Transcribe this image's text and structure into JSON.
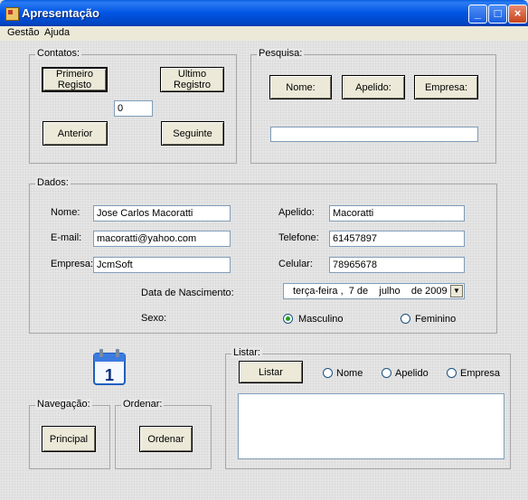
{
  "window": {
    "title": "Apresentação"
  },
  "menu": {
    "items": [
      "Gestão",
      "Ajuda"
    ]
  },
  "contatos": {
    "legend": "Contatos:",
    "first_label": "Primeiro Registo",
    "last_label": "Ultimo Registro",
    "record_index": "0",
    "prev_label": "Anterior",
    "next_label": "Seguinte"
  },
  "pesquisa": {
    "legend": "Pesquisa:",
    "nome_label": "Nome:",
    "apelido_label": "Apelido:",
    "empresa_label": "Empresa:",
    "search_value": ""
  },
  "dados": {
    "legend": "Dados:",
    "nome_label": "Nome:",
    "nome_value": "Jose Carlos Macoratti",
    "email_label": "E-mail:",
    "email_value": "macoratti@yahoo.com",
    "empresa_label": "Empresa:",
    "empresa_value": "JcmSoft",
    "apelido_label": "Apelido:",
    "apelido_value": "Macoratti",
    "telefone_label": "Telefone:",
    "telefone_value": "61457897",
    "celular_label": "Celular:",
    "celular_value": "78965678",
    "nascimento_label": "Data de Nascimento:",
    "nascimento_value": "terça-feira ,  7 de    julho    de 2009",
    "sexo_label": "Sexo:",
    "masculino_label": "Masculino",
    "feminino_label": "Feminino",
    "sexo_selected": "Masculino"
  },
  "navegacao": {
    "legend": "Navegação:",
    "principal_label": "Principal"
  },
  "ordenar": {
    "legend": "Ordenar:",
    "ordenar_label": "Ordenar"
  },
  "listar": {
    "legend": "Listar:",
    "listar_label": "Listar",
    "nome_label": "Nome",
    "apelido_label": "Apelido",
    "empresa_label": "Empresa"
  },
  "icons": {
    "calendar": "calendar-icon",
    "calendar_day": "1"
  }
}
